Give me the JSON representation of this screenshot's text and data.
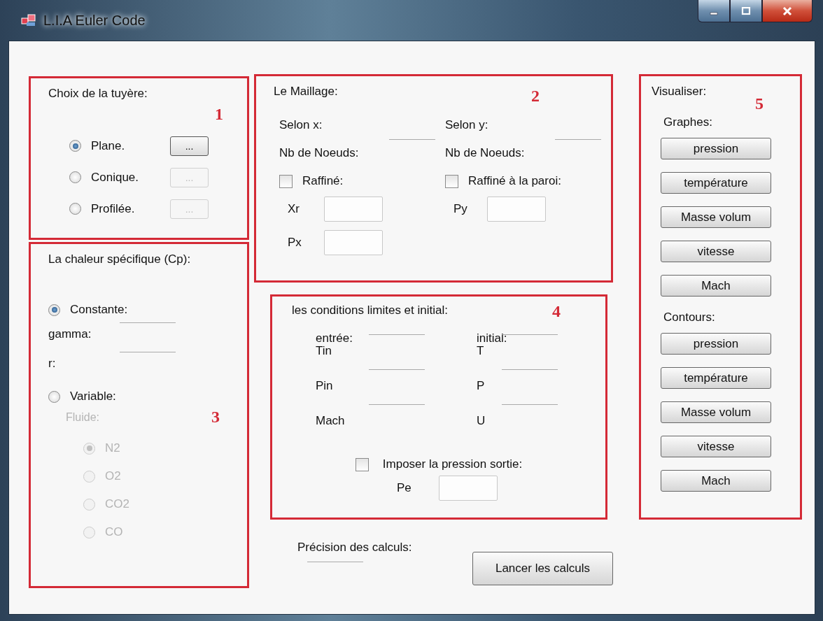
{
  "window": {
    "title": "L.I.A Euler Code"
  },
  "nozzle": {
    "number": "1",
    "title": "Choix de la tuyère:",
    "options": [
      {
        "label": "Plane.",
        "selected": true,
        "button": "...",
        "button_disabled": false
      },
      {
        "label": "Conique.",
        "selected": false,
        "button": "...",
        "button_disabled": true
      },
      {
        "label": "Profilée.",
        "selected": false,
        "button": "...",
        "button_disabled": true
      }
    ]
  },
  "heat": {
    "number": "3",
    "title": "La chaleur spécifique (Cp):",
    "constant": {
      "label": "Constante:",
      "selected": true,
      "fields": [
        {
          "label": "gamma:"
        },
        {
          "label": "r:"
        }
      ]
    },
    "variable": {
      "label": "Variable:",
      "selected": false,
      "fluid": {
        "title": "Fluide:",
        "disabled": true,
        "options": [
          {
            "label": "N2",
            "selected": true
          },
          {
            "label": "O2",
            "selected": false
          },
          {
            "label": "CO2",
            "selected": false
          },
          {
            "label": "CO",
            "selected": false
          }
        ]
      }
    }
  },
  "mesh": {
    "number": "2",
    "title": "Le Maillage:",
    "axes": [
      {
        "heading": "Selon x:",
        "nodes_label": "Nb de Noeuds:",
        "refine": {
          "label": "Raffiné:",
          "checked": false
        },
        "fields": [
          {
            "label": "Xr"
          },
          {
            "label": "Px"
          }
        ]
      },
      {
        "heading": "Selon y:",
        "nodes_label": "Nb de Noeuds:",
        "refine": {
          "label": "Raffiné à la paroi:",
          "checked": false
        },
        "fields": [
          {
            "label": "Py"
          }
        ]
      }
    ]
  },
  "conditions": {
    "number": "4",
    "title": "les conditions limites et initial:",
    "groups": [
      {
        "heading": "entrée:",
        "fields": [
          {
            "label": "Tin"
          },
          {
            "label": "Pin"
          },
          {
            "label": "Mach"
          }
        ]
      },
      {
        "heading": "initial:",
        "fields": [
          {
            "label": "T"
          },
          {
            "label": "P"
          },
          {
            "label": "U"
          }
        ]
      }
    ],
    "outlet": {
      "label": "Imposer la pression sortie:",
      "checked": false
    },
    "pe": {
      "label": "Pe"
    }
  },
  "visualize": {
    "number": "5",
    "title": "Visualiser:",
    "groups": [
      {
        "heading": "Graphes:",
        "buttons": [
          "pression",
          "température",
          "Masse volum",
          "vitesse",
          "Mach"
        ]
      },
      {
        "heading": "Contours:",
        "buttons": [
          "pression",
          "température",
          "Masse volum",
          "vitesse",
          "Mach"
        ]
      }
    ]
  },
  "precision": {
    "label": "Précision des calculs:"
  },
  "run_button": "Lancer les calculs"
}
